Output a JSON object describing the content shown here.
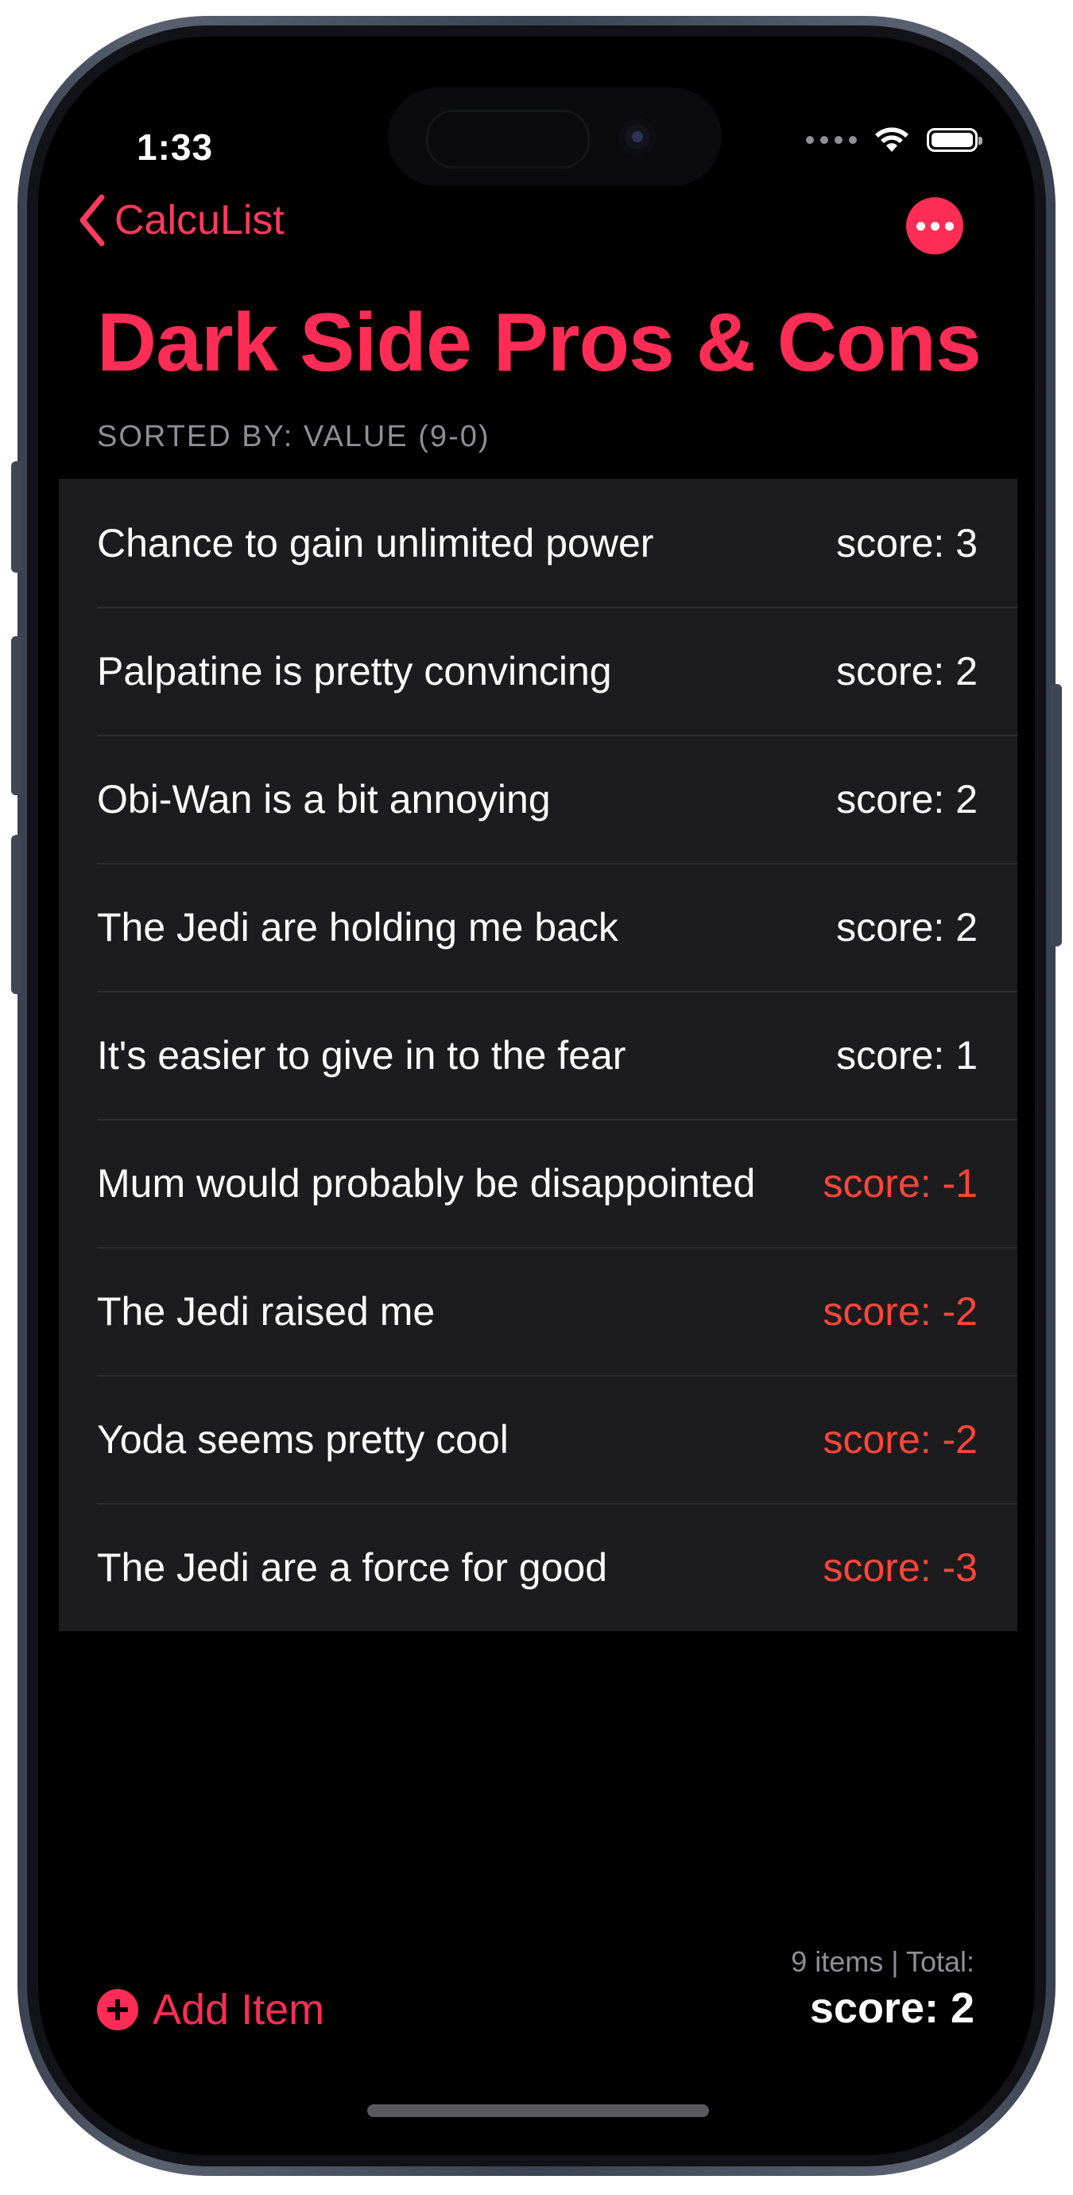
{
  "status_bar": {
    "time": "1:33"
  },
  "nav": {
    "back_label": "CalcuList"
  },
  "header": {
    "title": "Dark Side Pros & Cons",
    "sort_label": "SORTED BY: VALUE (9-0)"
  },
  "items": [
    {
      "title": "Chance to gain unlimited power",
      "score": "score: 3"
    },
    {
      "title": "Palpatine is pretty convincing",
      "score": "score: 2"
    },
    {
      "title": "Obi-Wan is a bit annoying",
      "score": "score: 2"
    },
    {
      "title": "The Jedi are holding me back",
      "score": "score: 2"
    },
    {
      "title": "It's easier to give in to the fear",
      "score": "score: 1"
    },
    {
      "title": "Mum would probably be disappointed",
      "score": "score: -1"
    },
    {
      "title": "The Jedi raised me",
      "score": "score: -2"
    },
    {
      "title": "Yoda seems pretty cool",
      "score": "score: -2"
    },
    {
      "title": "The Jedi are a force for good",
      "score": "score: -3"
    }
  ],
  "footer": {
    "add_label": "Add Item",
    "count_total": "9 items | Total:",
    "total_score": "score: 2"
  },
  "colors": {
    "accent": "#ff2d55",
    "negative": "#ff453a",
    "cell_bg": "#1c1c1e"
  }
}
